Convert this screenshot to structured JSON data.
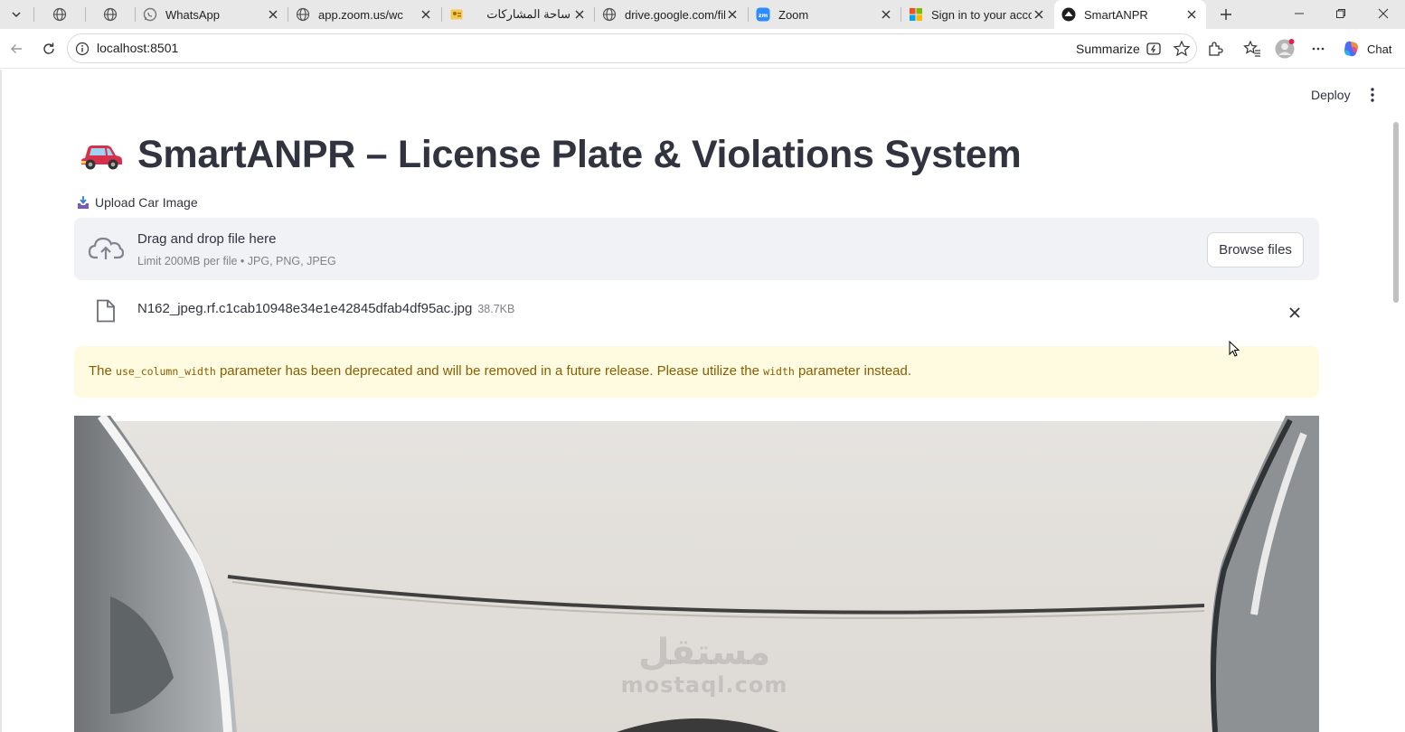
{
  "browser": {
    "tabs": [
      {
        "title": "",
        "icon": "globe-icon",
        "pinned": true
      },
      {
        "title": "",
        "icon": "globe-icon",
        "pinned": true
      },
      {
        "title": "WhatsApp",
        "icon": "whatsapp-icon"
      },
      {
        "title": "app.zoom.us/wc",
        "icon": "globe-icon"
      },
      {
        "title": "ساحة المشاركات",
        "icon": "contact-card-icon"
      },
      {
        "title": "drive.google.com/file",
        "icon": "globe-icon"
      },
      {
        "title": "Zoom",
        "icon": "zoom-icon"
      },
      {
        "title": "Sign in to your accou",
        "icon": "microsoft-icon"
      },
      {
        "title": "SmartANPR",
        "icon": "streamlit-icon",
        "active": true
      }
    ],
    "address": "localhost:8501",
    "summarize_label": "Summarize",
    "chat_label": "Chat"
  },
  "app": {
    "deploy_label": "Deploy",
    "title": "SmartANPR – License Plate & Violations System",
    "title_icon": "car-emoji-icon",
    "uploader": {
      "label": "Upload Car Image",
      "label_icon": "inbox-tray-emoji-icon",
      "drop_title": "Drag and drop file here",
      "drop_sub": "Limit 200MB per file • JPG, PNG, JPEG",
      "browse_label": "Browse files"
    },
    "file": {
      "name": "N162_jpeg.rf.c1cab10948e34e1e42845dfab4df95ac.jpg",
      "size": "38.7KB"
    },
    "warning": {
      "prefix": "The ",
      "code1": "use_column_width",
      "middle": " parameter has been deprecated and will be removed in a future release. Please utilize the ",
      "code2": "width",
      "suffix": " parameter instead."
    },
    "watermark": {
      "ar": "مستقل",
      "en": "mostaql.com"
    }
  },
  "colors": {
    "accent_yellow_bg": "#fffbe0",
    "warning_text": "#8a5d00",
    "dropzone_bg": "#f0f2f6",
    "text": "#31333f"
  }
}
